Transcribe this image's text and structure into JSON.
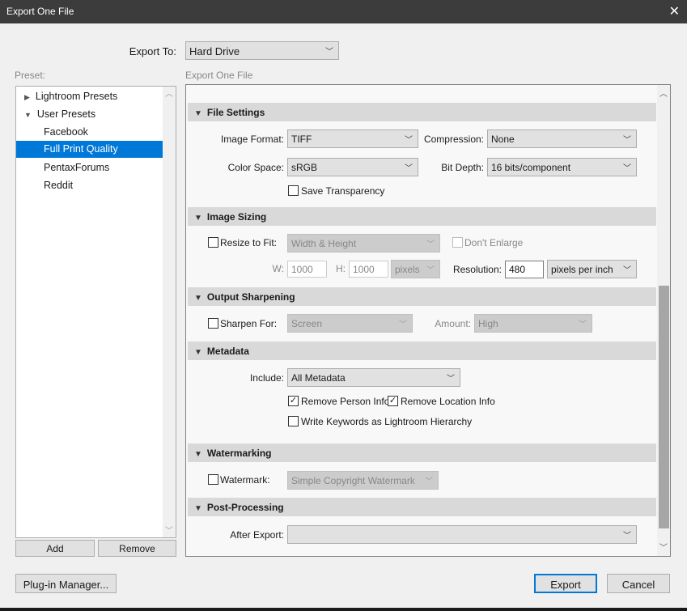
{
  "window": {
    "title": "Export One File",
    "close_icon": "close-icon"
  },
  "export_to": {
    "label": "Export To:",
    "value": "Hard Drive"
  },
  "preset": {
    "label": "Preset:",
    "items": [
      {
        "label": "Lightroom Presets",
        "expanded": false
      },
      {
        "label": "User Presets",
        "expanded": true
      },
      {
        "label": "Facebook"
      },
      {
        "label": "Full Print Quality",
        "selected": true
      },
      {
        "label": "PentaxForums"
      },
      {
        "label": "Reddit"
      }
    ],
    "add": "Add",
    "remove": "Remove"
  },
  "panel_label": "Export One File",
  "file_settings": {
    "title": "File Settings",
    "image_format_label": "Image Format:",
    "image_format": "TIFF",
    "compression_label": "Compression:",
    "compression": "None",
    "color_space_label": "Color Space:",
    "color_space": "sRGB",
    "bit_depth_label": "Bit Depth:",
    "bit_depth": "16 bits/component",
    "save_transparency": "Save Transparency"
  },
  "image_sizing": {
    "title": "Image Sizing",
    "resize_label": "Resize to Fit:",
    "resize_mode": "Width & Height",
    "dont_enlarge": "Don't Enlarge",
    "w_label": "W:",
    "w": "1000",
    "h_label": "H:",
    "h": "1000",
    "unit": "pixels",
    "resolution_label": "Resolution:",
    "resolution": "480",
    "resolution_unit": "pixels per inch"
  },
  "output_sharpening": {
    "title": "Output Sharpening",
    "sharpen_label": "Sharpen For:",
    "sharpen_for": "Screen",
    "amount_label": "Amount:",
    "amount": "High"
  },
  "metadata": {
    "title": "Metadata",
    "include_label": "Include:",
    "include": "All Metadata",
    "remove_person": "Remove Person Info",
    "remove_location": "Remove Location Info",
    "write_keywords": "Write Keywords as Lightroom Hierarchy"
  },
  "watermarking": {
    "title": "Watermarking",
    "watermark_label": "Watermark:",
    "watermark": "Simple Copyright Watermark"
  },
  "post_processing": {
    "title": "Post-Processing",
    "after_export_label": "After Export:",
    "after_export": ""
  },
  "footer": {
    "plugin_manager": "Plug-in Manager...",
    "export": "Export",
    "cancel": "Cancel"
  },
  "colors": {
    "accent": "#0078d7",
    "titlebar": "#3c3c3c"
  }
}
